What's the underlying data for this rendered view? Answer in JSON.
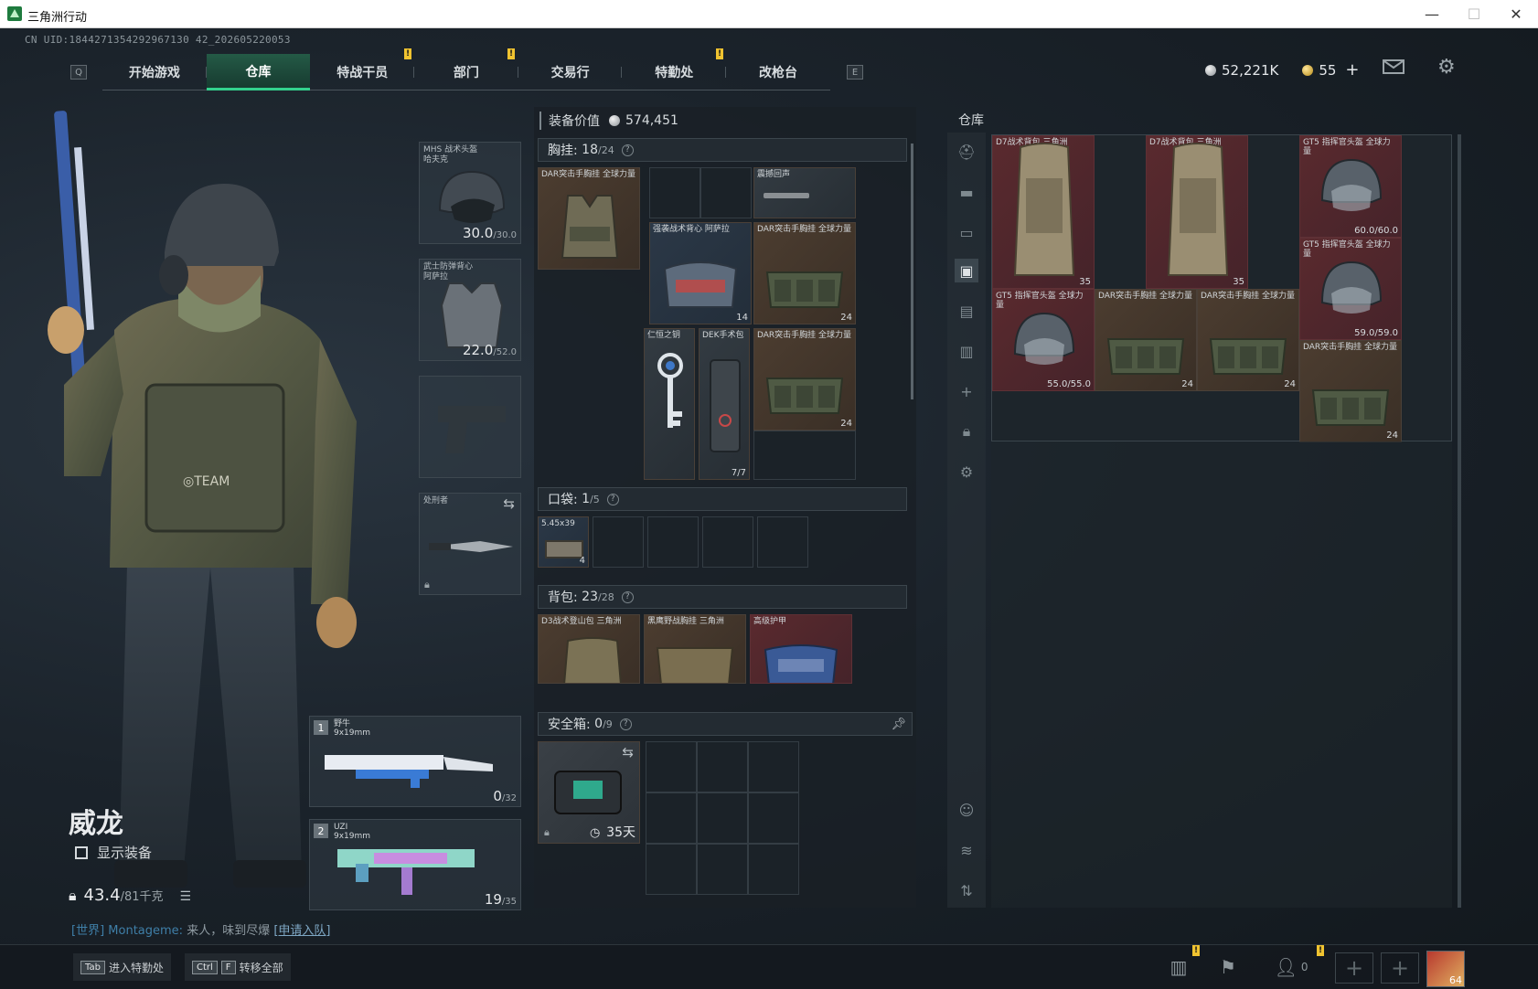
{
  "window": {
    "title": "三角洲行动",
    "minimize": "—",
    "maximize": "☐",
    "close": "✕"
  },
  "uid": "CN UID:1844271354292967130 42_202605220053",
  "nav": {
    "left_key": "Q",
    "right_key": "E",
    "tabs": [
      {
        "label": "开始游戏"
      },
      {
        "label": "仓库"
      },
      {
        "label": "特战干员"
      },
      {
        "label": "部门"
      },
      {
        "label": "交易行"
      },
      {
        "label": "特勤处"
      },
      {
        "label": "改枪台"
      }
    ],
    "active_tab": "仓库",
    "notif_mark": "!"
  },
  "currency": {
    "silver": "52,221K",
    "gold": "55",
    "plus": "+"
  },
  "operator": {
    "name": "威龙",
    "show_equipment": "显示装备",
    "weight": "43.4",
    "weight_max": "/81千克"
  },
  "chat": {
    "channel": "[世界]",
    "user": "Montageme:",
    "text": "来人，味到尽爆",
    "join": "[申请入队]"
  },
  "bottom": {
    "enter_tech": {
      "key": "Tab",
      "label": "进入特勤处"
    },
    "transfer_all": {
      "key1": "Ctrl",
      "key2": "F",
      "label": "转移全部"
    },
    "friends_count": "0",
    "avatar_level": "64"
  },
  "equipment": {
    "helmet": {
      "name": "MHS 战术头盔",
      "sub": "哈夫克",
      "dur": "30.0",
      "dur_max": "/30.0"
    },
    "armor": {
      "name": "武士防弹背心",
      "sub": "阿萨拉",
      "dur": "22.0",
      "dur_max": "/52.0"
    },
    "knife": {
      "name": "处刑者"
    },
    "primary": {
      "index": "1",
      "name": "野牛",
      "ammo": "9x19mm",
      "mag": "0",
      "mag_max": "/32"
    },
    "secondary": {
      "index": "2",
      "name": "UZI",
      "ammo": "9x19mm",
      "mag": "19",
      "mag_max": "/35"
    }
  },
  "loadout": {
    "value_label": "装备价值",
    "value": "574,451",
    "chest": {
      "label": "胸挂:",
      "used": "18",
      "max": "/24",
      "q": "?"
    },
    "chest_items": [
      {
        "name": "DAR突击手胸挂 全球力量"
      },
      {
        "name": "震撼回声"
      },
      {
        "name": "强袭战术背心 阿萨拉",
        "count": "14"
      },
      {
        "name": "DAR突击手胸挂 全球力量",
        "count": "24"
      },
      {
        "name": "仁恒之钥"
      },
      {
        "name": "DEK手术包",
        "count": "7/7"
      },
      {
        "name": "DAR突击手胸挂 全球力量",
        "count": "24"
      }
    ],
    "pocket": {
      "label": "口袋:",
      "used": "1",
      "max": "/5",
      "q": "?"
    },
    "pocket_items": [
      {
        "name": "5.45x39",
        "count": "4"
      }
    ],
    "backpack": {
      "label": "背包:",
      "used": "23",
      "max": "/28",
      "q": "?"
    },
    "backpack_items": [
      {
        "name": "D3战术登山包 三角洲"
      },
      {
        "name": "黑鹰野战胸挂 三角洲"
      },
      {
        "name": "高级护甲"
      }
    ],
    "safe": {
      "label": "安全箱:",
      "used": "0",
      "max": "/9",
      "q": "?",
      "days": "35天"
    }
  },
  "warehouse": {
    "title": "仓库",
    "items": [
      {
        "name": "D7战术背包 三角洲",
        "count": "35"
      },
      {
        "name": "D7战术背包 三角洲",
        "count": "35"
      },
      {
        "name": "GT5 指挥官头盔 全球力量",
        "count": "60.0/60.0"
      },
      {
        "name": "GT5 指挥官头盔 全球力量",
        "count": "59.0/59.0"
      },
      {
        "name": "GT5 指挥官头盔 全球力量",
        "count": "55.0/55.0"
      },
      {
        "name": "DAR突击手胸挂 全球力量",
        "count": "24"
      },
      {
        "name": "DAR突击手胸挂 全球力量",
        "count": "24"
      },
      {
        "name": "DAR突击手胸挂 全球力量",
        "count": "24"
      }
    ]
  }
}
